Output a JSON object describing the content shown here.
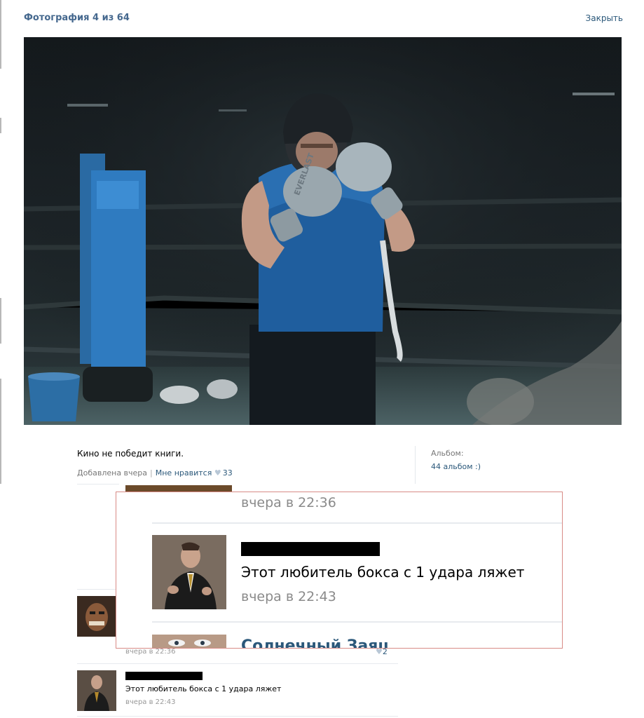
{
  "header": {
    "title": "Фотография 4 из 64",
    "close_label": "Закрыть"
  },
  "photo": {
    "glove_brand": "EVERLAST"
  },
  "post": {
    "caption": "Кино не победит книги.",
    "added_label": "Добавлена вчера",
    "like_label": "Мне нравится",
    "like_count": "33"
  },
  "album": {
    "label": "Альбом:",
    "link": "44 альбом :)"
  },
  "zoom": {
    "prev_time": "вчера в 22:36",
    "comment_text": "Этот любитель бокса с 1 удара ляжет",
    "comment_time": "вчера в 22:43",
    "next_name": "Солнечный Заяц"
  },
  "comments": [
    {
      "time": "вчера в 22:36",
      "likes": "2"
    },
    {
      "text": "Этот любитель бокса с 1 удара ляжет",
      "time": "вчера в 22:43"
    }
  ],
  "colors": {
    "link": "#2b587a",
    "title": "#45688e",
    "zoom_border": "#d88b86"
  }
}
